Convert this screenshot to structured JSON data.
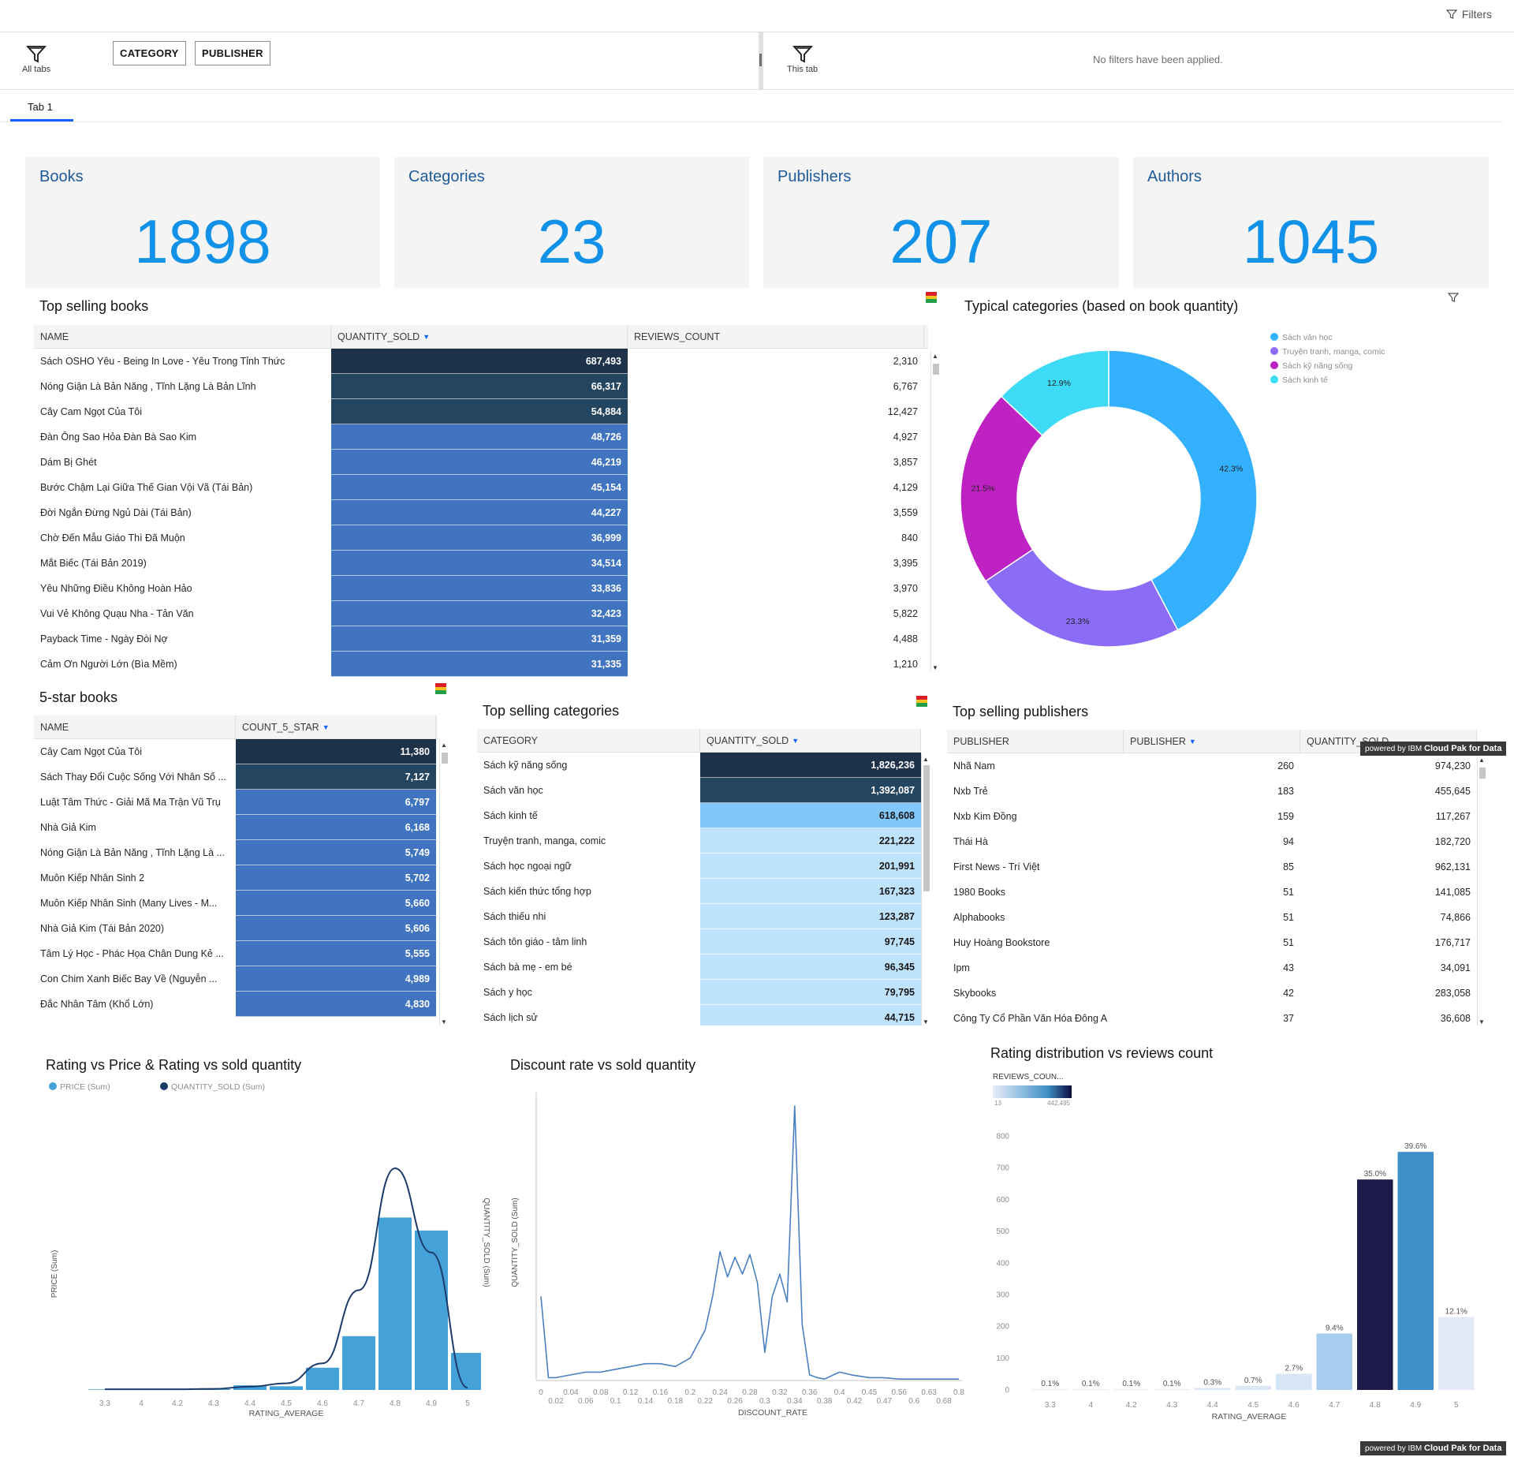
{
  "topbar": {
    "filters_label": "Filters"
  },
  "filterbar": {
    "all_tabs_label": "All tabs",
    "pills": [
      "CATEGORY",
      "PUBLISHER"
    ],
    "this_tab_label": "This tab",
    "no_filters": "No filters have been applied."
  },
  "tabs": [
    {
      "label": "Tab 1",
      "active": true
    }
  ],
  "kpis": [
    {
      "title": "Books",
      "value": "1898"
    },
    {
      "title": "Categories",
      "value": "23"
    },
    {
      "title": "Publishers",
      "value": "207"
    },
    {
      "title": "Authors",
      "value": "1045"
    }
  ],
  "colors": {
    "kpi_value": "#1192e8",
    "kpi_title": "#1e5a9a",
    "bar": "#45a2d9",
    "line": "#1c3b6b"
  },
  "top_books": {
    "title": "Top selling books",
    "columns": [
      "NAME",
      "QUANTITY_SOLD",
      "REVIEWS_COUNT"
    ],
    "rows": [
      [
        "Sách OSHO Yêu - Being In Love - Yêu Trong Tỉnh Thức",
        "687,493",
        "2,310"
      ],
      [
        "Nóng Giận Là Bản Năng , Tĩnh Lặng Là Bản Lĩnh",
        "66,317",
        "6,767"
      ],
      [
        "Cây Cam Ngọt Của Tôi",
        "54,884",
        "12,427"
      ],
      [
        "Đàn Ông Sao Hỏa Đàn Bà Sao Kim",
        "48,726",
        "4,927"
      ],
      [
        "Dám Bị Ghét",
        "46,219",
        "3,857"
      ],
      [
        "Bước Chậm Lại Giữa Thế Gian Vội Vã (Tái Bản)",
        "45,154",
        "4,129"
      ],
      [
        "Đời Ngắn Đừng Ngủ Dài (Tái Bản)",
        "44,227",
        "3,559"
      ],
      [
        "Chờ Đến Mẫu Giáo Thì Đã Muộn",
        "36,999",
        "840"
      ],
      [
        "Mắt Biếc (Tái Bản 2019)",
        "34,514",
        "3,395"
      ],
      [
        "Yêu Những Điều Không Hoàn Hảo",
        "33,836",
        "3,970"
      ],
      [
        "Vui Vẻ Không Quạu Nha - Tản Văn",
        "32,423",
        "5,822"
      ],
      [
        "Payback Time - Ngày Đòi Nợ",
        "31,359",
        "4,488"
      ],
      [
        "Cảm Ơn Người Lớn (Bìa Mềm)",
        "31,335",
        "1,210"
      ]
    ]
  },
  "typical_categories": {
    "title": "Typical categories (based on book quantity)",
    "legend": [
      "Sách văn học",
      "Truyện tranh, manga, comic",
      "Sách kỹ năng sống",
      "Sách kinh tế"
    ],
    "labels": [
      "42.3%",
      "23.3%",
      "21.5%",
      "12.9%"
    ]
  },
  "five_star": {
    "title": "5-star books",
    "columns": [
      "NAME",
      "COUNT_5_STAR"
    ],
    "rows": [
      [
        "Cây Cam Ngọt Của Tôi",
        "11,380"
      ],
      [
        "Sách Thay Đổi Cuộc Sống Với Nhân Số ...",
        "7,127"
      ],
      [
        "Luật Tâm Thức - Giải Mã Ma Trận Vũ Trụ",
        "6,797"
      ],
      [
        "Nhà Giả Kim",
        "6,168"
      ],
      [
        "Nóng Giận Là Bản Năng , Tĩnh Lặng Là ...",
        "5,749"
      ],
      [
        "Muôn Kiếp Nhân Sinh 2",
        "5,702"
      ],
      [
        "Muôn Kiếp Nhân Sinh (Many Lives - M...",
        "5,660"
      ],
      [
        "Nhà Giả Kim (Tái Bản 2020)",
        "5,606"
      ],
      [
        "Tâm Lý Học - Phác Họa Chân Dung Kẻ ...",
        "5,555"
      ],
      [
        "Con Chim Xanh Biếc Bay Về (Nguyễn ...",
        "4,989"
      ],
      [
        "Đắc Nhân Tâm (Khổ Lớn)",
        "4,830"
      ]
    ]
  },
  "top_categories": {
    "title": "Top selling categories",
    "columns": [
      "CATEGORY",
      "QUANTITY_SOLD"
    ],
    "rows": [
      [
        "Sách kỹ năng sống",
        "1,826,236"
      ],
      [
        "Sách văn học",
        "1,392,087"
      ],
      [
        "Sách kinh tế",
        "618,608"
      ],
      [
        "Truyện tranh, manga, comic",
        "221,222"
      ],
      [
        "Sách học ngoại ngữ",
        "201,991"
      ],
      [
        "Sách kiến thức tổng hợp",
        "167,323"
      ],
      [
        "Sách thiếu nhi",
        "123,287"
      ],
      [
        "Sách tôn giáo - tâm linh",
        "97,745"
      ],
      [
        "Sách bà mẹ - em bé",
        "96,345"
      ],
      [
        "Sách y học",
        "79,795"
      ],
      [
        "Sách lịch sử",
        "44,715"
      ]
    ]
  },
  "top_publishers": {
    "title": "Top selling publishers",
    "columns": [
      "PUBLISHER",
      "PUBLISHER",
      "QUANTITY_SOLD"
    ],
    "rows": [
      [
        "Nhã Nam",
        "260",
        "974,230"
      ],
      [
        "Nxb Trẻ",
        "183",
        "455,645"
      ],
      [
        "Nxb Kim Đồng",
        "159",
        "117,267"
      ],
      [
        "Thái Hà",
        "94",
        "182,720"
      ],
      [
        "First News - Trí Việt",
        "85",
        "962,131"
      ],
      [
        "1980 Books",
        "51",
        "141,085"
      ],
      [
        "Alphabooks",
        "51",
        "74,866"
      ],
      [
        "Huy Hoàng Bookstore",
        "51",
        "176,717"
      ],
      [
        "Ipm",
        "43",
        "34,091"
      ],
      [
        "Skybooks",
        "42",
        "283,058"
      ],
      [
        "Công Ty Cổ Phần Văn Hóa Đông A",
        "37",
        "36,608"
      ]
    ]
  },
  "ibm_badge": {
    "prefix": "powered by IBM",
    "brand": "Cloud Pak for Data"
  },
  "chart_data": [
    {
      "type": "bar",
      "title": "Rating vs Price & Rating vs sold quantity",
      "legend": [
        "PRICE (Sum)",
        "QUANTITY_SOLD (Sum)"
      ],
      "xlabel": "RATING_AVERAGE",
      "ylabel": "PRICE (Sum)",
      "categories": [
        "3.3",
        "4",
        "4.2",
        "4.3",
        "4.4",
        "4.5",
        "4.6",
        "4.7",
        "4.8",
        "4.9",
        "5"
      ],
      "series": [
        {
          "name": "PRICE (Sum)",
          "values": [
            0.3,
            0.3,
            0.3,
            0.5,
            2.5,
            2,
            12,
            29,
            93,
            86,
            20
          ]
        },
        {
          "name": "QUANTITY_SOLD (Sum)",
          "values": [
            0.3,
            0.3,
            0.3,
            0.5,
            1.5,
            3,
            12,
            45,
            100,
            62,
            1
          ]
        }
      ]
    },
    {
      "type": "line",
      "title": "Discount rate vs sold quantity",
      "xlabel": "DISCOUNT_RATE",
      "ylabel": "QUANTITY_SOLD (Sum)",
      "x_ticks_top": [
        "0",
        "0.04",
        "0.08",
        "0.12",
        "0.16",
        "0.2",
        "0.24",
        "0.28",
        "0.32",
        "0.36",
        "0.4",
        "0.45",
        "0.56",
        "0.63",
        "0.8"
      ],
      "x_ticks_bottom": [
        "0.02",
        "0.06",
        "0.1",
        "0.14",
        "0.18",
        "0.22",
        "0.26",
        "0.3",
        "0.34",
        "0.38",
        "0.42",
        "0.47",
        "0.6",
        "0.68"
      ],
      "x": [
        0,
        0.01,
        0.02,
        0.04,
        0.06,
        0.08,
        0.1,
        0.12,
        0.14,
        0.16,
        0.18,
        0.2,
        0.22,
        0.23,
        0.24,
        0.25,
        0.26,
        0.27,
        0.28,
        0.29,
        0.3,
        0.31,
        0.32,
        0.33,
        0.34,
        0.35,
        0.36,
        0.37,
        0.38,
        0.4,
        0.42,
        0.45,
        0.5,
        0.56,
        0.6,
        0.63,
        0.68,
        0.8
      ],
      "y": [
        30,
        1,
        1,
        2,
        3,
        3,
        4,
        5,
        6,
        6,
        5,
        8,
        18,
        30,
        46,
        37,
        44,
        38,
        45,
        35,
        10,
        30,
        38,
        28,
        98,
        20,
        2,
        1,
        0.5,
        3,
        2,
        1,
        1,
        0.5,
        0.5,
        0.5,
        0.5,
        0.5
      ],
      "y_relative": true
    },
    {
      "type": "bar",
      "title": "Rating distribution vs reviews count",
      "legend_title": "REVIEWS_COUN...",
      "legend_range": [
        "13",
        "442,495"
      ],
      "xlabel": "RATING_AVERAGE",
      "categories": [
        "3.3",
        "4",
        "4.2",
        "4.3",
        "4.4",
        "4.5",
        "4.6",
        "4.7",
        "4.8",
        "4.9",
        "5"
      ],
      "values": [
        2,
        2,
        2,
        2,
        6,
        13,
        51,
        178,
        664,
        751,
        230
      ],
      "labels": [
        "0.1%",
        "0.1%",
        "0.1%",
        "0.1%",
        "0.3%",
        "0.7%",
        "2.7%",
        "9.4%",
        "35.0%",
        "39.6%",
        "12.1%"
      ],
      "bar_colors": [
        "#dce6f4",
        "#dce6f4",
        "#dce6f4",
        "#dce6f4",
        "#dce6f4",
        "#dce6f4",
        "#d6e6f6",
        "#a9cdee",
        "#1b1a4b",
        "#3e8fc7",
        "#e3e9f8"
      ],
      "y_ticks": [
        "0",
        "100",
        "200",
        "300",
        "400",
        "500",
        "600",
        "700",
        "800"
      ],
      "ylim": [
        0,
        800
      ]
    }
  ]
}
